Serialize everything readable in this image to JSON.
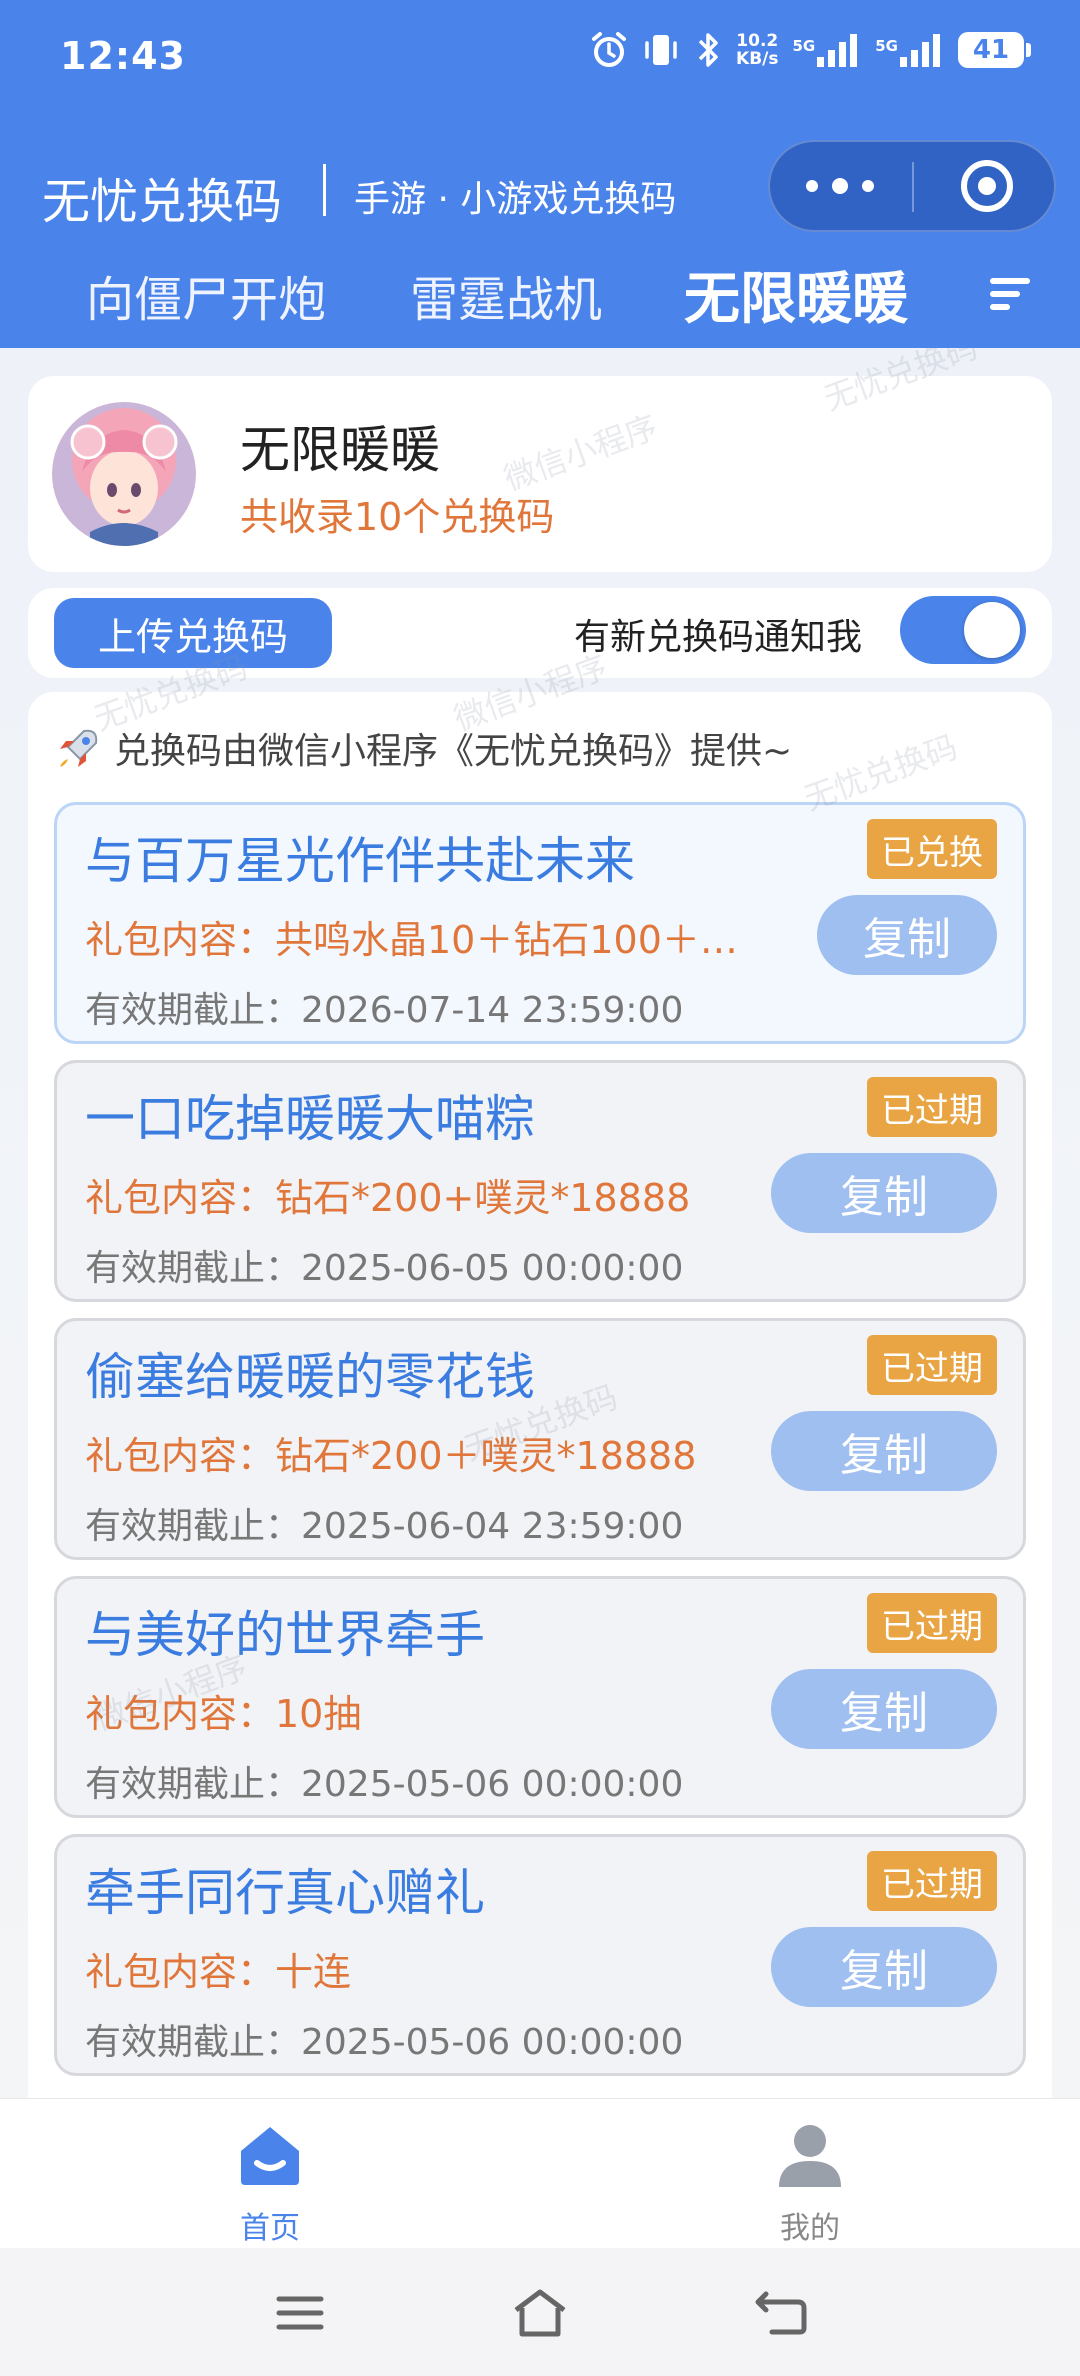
{
  "status_bar": {
    "time": "12:43",
    "net_speed_value": "10.2",
    "net_speed_unit": "KB/s",
    "signal1_label": "5G",
    "signal2_label": "5G",
    "battery": "41"
  },
  "header": {
    "app_title": "无忧兑换码",
    "app_subtitle": "手游 · 小游戏兑换码",
    "tabs": [
      {
        "label": "向僵尸开炮",
        "active": false
      },
      {
        "label": "雷霆战机",
        "active": false
      },
      {
        "label": "无限暖暖",
        "active": true
      }
    ]
  },
  "game": {
    "name": "无限暖暖",
    "count_text": "共收录10个兑换码"
  },
  "actions": {
    "upload_label": "上传兑换码",
    "notify_label": "有新兑换码通知我",
    "notify_on": true
  },
  "list": {
    "provider_text": "兑换码由微信小程序《无忧兑换码》提供~",
    "codes": [
      {
        "title": "与百万星光作伴共赴未来",
        "gift": "礼包内容：共鸣水晶10＋钻石100＋…",
        "expire": "有效期截止：2026-07-14 23:59:00",
        "status": "已兑换",
        "copy": "复制"
      },
      {
        "title": "一口吃掉暖暖大喵粽",
        "gift": "礼包内容：钻石*200+噗灵*18888",
        "expire": "有效期截止：2025-06-05 00:00:00",
        "status": "已过期",
        "copy": "复制"
      },
      {
        "title": "偷塞给暖暖的零花钱",
        "gift": "礼包内容：钻石*200＋噗灵*18888",
        "expire": "有效期截止：2025-06-04 23:59:00",
        "status": "已过期",
        "copy": "复制"
      },
      {
        "title": "与美好的世界牵手",
        "gift": "礼包内容：10抽",
        "expire": "有效期截止：2025-05-06 00:00:00",
        "status": "已过期",
        "copy": "复制"
      },
      {
        "title": "牵手同行真心赠礼",
        "gift": "礼包内容：十连",
        "expire": "有效期截止：2025-05-06 00:00:00",
        "status": "已过期",
        "copy": "复制"
      }
    ]
  },
  "watermarks": [
    "微信小程序",
    "无忧兑换码"
  ],
  "bottom_nav": [
    {
      "label": "首页",
      "icon": "home-icon",
      "active": true
    },
    {
      "label": "我的",
      "icon": "user-icon",
      "active": false
    }
  ],
  "colors": {
    "brand_blue": "#4a84ea",
    "orange": "#e0763a",
    "badge": "#e9a544",
    "copy_button": "#9fbff0"
  }
}
